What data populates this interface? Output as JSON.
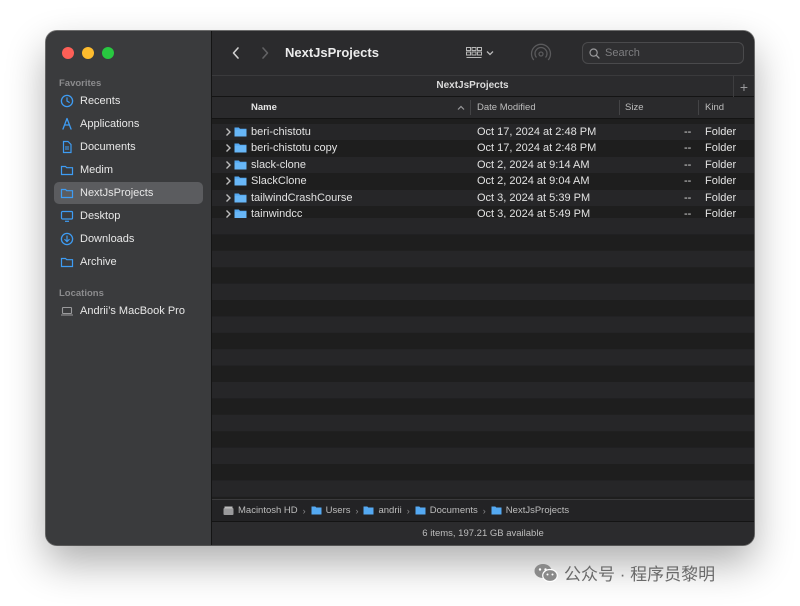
{
  "window": {
    "title": "NextJsProjects",
    "tab_title": "NextJsProjects",
    "search_placeholder": "Search"
  },
  "sidebar": {
    "favorites_title": "Favorites",
    "favorites": [
      {
        "label": "Recents",
        "icon": "clock-icon"
      },
      {
        "label": "Applications",
        "icon": "applications-icon"
      },
      {
        "label": "Documents",
        "icon": "document-icon"
      },
      {
        "label": "Medim",
        "icon": "folder-icon"
      },
      {
        "label": "NextJsProjects",
        "icon": "folder-icon",
        "selected": true
      },
      {
        "label": "Desktop",
        "icon": "desktop-icon"
      },
      {
        "label": "Downloads",
        "icon": "download-icon"
      },
      {
        "label": "Archive",
        "icon": "folder-icon"
      }
    ],
    "locations_title": "Locations",
    "locations": [
      {
        "label": "Andrii’s MacBook Pro",
        "icon": "laptop-icon"
      }
    ]
  },
  "columns": {
    "name": "Name",
    "date_modified": "Date Modified",
    "size": "Size",
    "kind": "Kind"
  },
  "files": [
    {
      "name": "beri-chistotu",
      "date": "Oct 17, 2024 at 2:48 PM",
      "size": "--",
      "kind": "Folder"
    },
    {
      "name": "beri-chistotu copy",
      "date": "Oct 17, 2024 at 2:48 PM",
      "size": "--",
      "kind": "Folder"
    },
    {
      "name": "slack-clone",
      "date": "Oct 2, 2024 at 9:14 AM",
      "size": "--",
      "kind": "Folder"
    },
    {
      "name": "SlackClone",
      "date": "Oct 2, 2024 at 9:04 AM",
      "size": "--",
      "kind": "Folder"
    },
    {
      "name": "tailwindCrashCourse",
      "date": "Oct 3, 2024 at 5:39 PM",
      "size": "--",
      "kind": "Folder"
    },
    {
      "name": "tainwindcc",
      "date": "Oct 3, 2024 at 5:49 PM",
      "size": "--",
      "kind": "Folder"
    }
  ],
  "path": [
    "Macintosh HD",
    "Users",
    "andrii",
    "Documents",
    "NextJsProjects"
  ],
  "status": "6 items, 197.21 GB available",
  "watermark": "公众号 · 程序员黎明",
  "colors": {
    "sidebar_bg": "#3a3b3d",
    "window_bg": "#1e1e1e",
    "folder_blue": "#54a9f2",
    "accent_icon": "#3e9cf3"
  }
}
